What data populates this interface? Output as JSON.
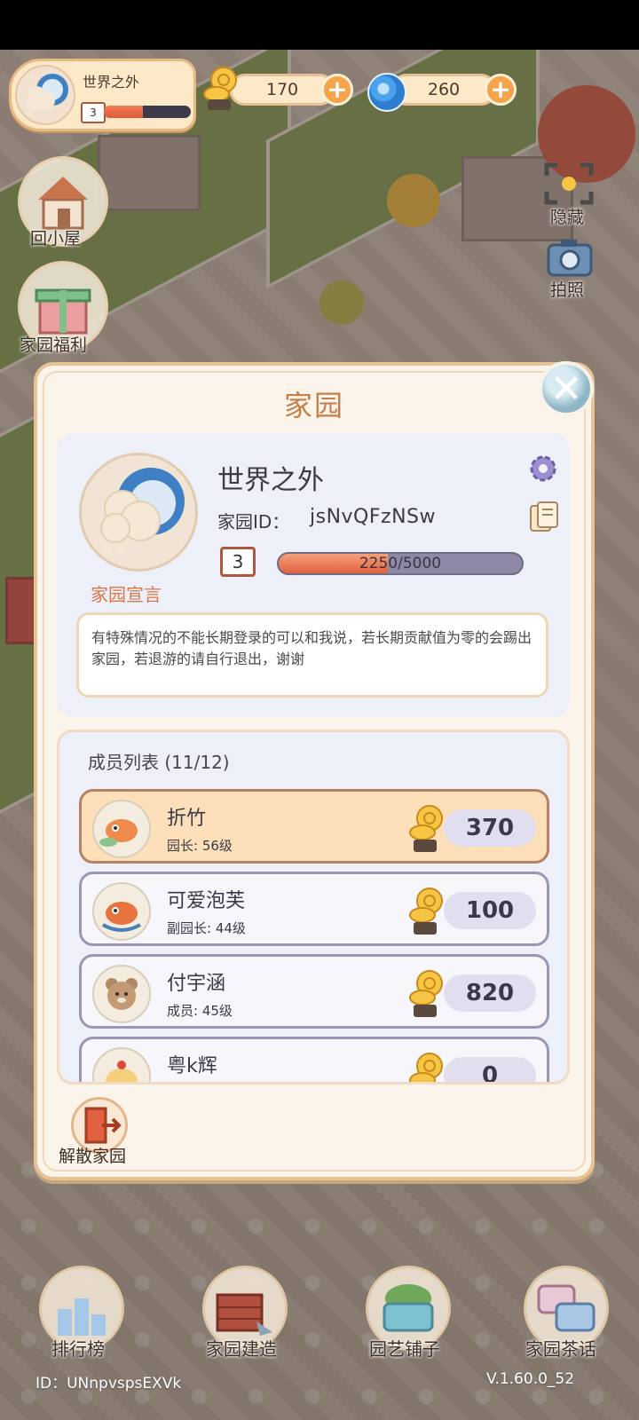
{
  "hud": {
    "garden_name": "世界之外",
    "level": "3",
    "snail_currency": "170",
    "swirl_currency": "260"
  },
  "side_buttons": {
    "home": "回小屋",
    "welfare": "家园福利",
    "hide": "隐藏",
    "photo": "拍照"
  },
  "panel": {
    "title": "家园",
    "garden_name": "世界之外",
    "id_label": "家园ID：",
    "id_value": "jsNvQFzNSw",
    "level": "3",
    "progress_text": "2250/5000",
    "progress_fraction": 0.45,
    "manifesto_label": "家园宣言",
    "manifesto": "有特殊情况的不能长期登录的可以和我说，若长期贡献值为零的会踢出家园，若退游的请自行退出，谢谢"
  },
  "members": {
    "header": "成员列表  (11/12)",
    "rows": [
      {
        "name": "折竹",
        "role": "园长: 56级",
        "score": "370"
      },
      {
        "name": "可爱泡芙",
        "role": "副园长: 44级",
        "score": "100"
      },
      {
        "name": "付宇涵",
        "role": "成员: 45级",
        "score": "820"
      },
      {
        "name": "粤k辉",
        "role": "",
        "score": "0"
      }
    ]
  },
  "dissolve_label": "解散家园",
  "bottom_nav": {
    "rank": "排行榜",
    "build": "家园建造",
    "shop": "园艺铺子",
    "chat": "家园茶话"
  },
  "footer": {
    "user_id": "ID：UNnpvspsEXVk",
    "version": "V.1.60.0_52"
  },
  "colors": {
    "panel_bg": "#fbf4ea",
    "title": "#c77e47",
    "accent_orange": "#f6a44a",
    "progress_fill": "#e0603f"
  }
}
